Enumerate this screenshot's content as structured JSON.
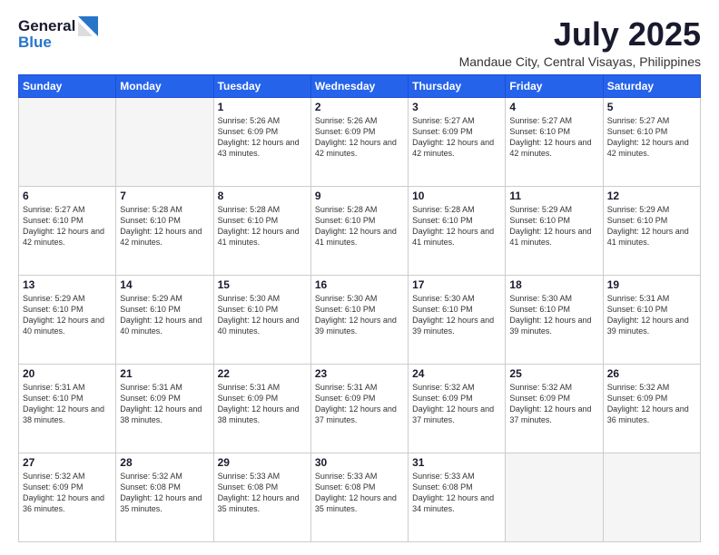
{
  "logo": {
    "general": "General",
    "blue": "Blue"
  },
  "title": "July 2025",
  "subtitle": "Mandaue City, Central Visayas, Philippines",
  "weekdays": [
    "Sunday",
    "Monday",
    "Tuesday",
    "Wednesday",
    "Thursday",
    "Friday",
    "Saturday"
  ],
  "weeks": [
    [
      {
        "day": "",
        "info": ""
      },
      {
        "day": "",
        "info": ""
      },
      {
        "day": "1",
        "info": "Sunrise: 5:26 AM\nSunset: 6:09 PM\nDaylight: 12 hours\nand 43 minutes."
      },
      {
        "day": "2",
        "info": "Sunrise: 5:26 AM\nSunset: 6:09 PM\nDaylight: 12 hours\nand 42 minutes."
      },
      {
        "day": "3",
        "info": "Sunrise: 5:27 AM\nSunset: 6:09 PM\nDaylight: 12 hours\nand 42 minutes."
      },
      {
        "day": "4",
        "info": "Sunrise: 5:27 AM\nSunset: 6:10 PM\nDaylight: 12 hours\nand 42 minutes."
      },
      {
        "day": "5",
        "info": "Sunrise: 5:27 AM\nSunset: 6:10 PM\nDaylight: 12 hours\nand 42 minutes."
      }
    ],
    [
      {
        "day": "6",
        "info": "Sunrise: 5:27 AM\nSunset: 6:10 PM\nDaylight: 12 hours\nand 42 minutes."
      },
      {
        "day": "7",
        "info": "Sunrise: 5:28 AM\nSunset: 6:10 PM\nDaylight: 12 hours\nand 42 minutes."
      },
      {
        "day": "8",
        "info": "Sunrise: 5:28 AM\nSunset: 6:10 PM\nDaylight: 12 hours\nand 41 minutes."
      },
      {
        "day": "9",
        "info": "Sunrise: 5:28 AM\nSunset: 6:10 PM\nDaylight: 12 hours\nand 41 minutes."
      },
      {
        "day": "10",
        "info": "Sunrise: 5:28 AM\nSunset: 6:10 PM\nDaylight: 12 hours\nand 41 minutes."
      },
      {
        "day": "11",
        "info": "Sunrise: 5:29 AM\nSunset: 6:10 PM\nDaylight: 12 hours\nand 41 minutes."
      },
      {
        "day": "12",
        "info": "Sunrise: 5:29 AM\nSunset: 6:10 PM\nDaylight: 12 hours\nand 41 minutes."
      }
    ],
    [
      {
        "day": "13",
        "info": "Sunrise: 5:29 AM\nSunset: 6:10 PM\nDaylight: 12 hours\nand 40 minutes."
      },
      {
        "day": "14",
        "info": "Sunrise: 5:29 AM\nSunset: 6:10 PM\nDaylight: 12 hours\nand 40 minutes."
      },
      {
        "day": "15",
        "info": "Sunrise: 5:30 AM\nSunset: 6:10 PM\nDaylight: 12 hours\nand 40 minutes."
      },
      {
        "day": "16",
        "info": "Sunrise: 5:30 AM\nSunset: 6:10 PM\nDaylight: 12 hours\nand 39 minutes."
      },
      {
        "day": "17",
        "info": "Sunrise: 5:30 AM\nSunset: 6:10 PM\nDaylight: 12 hours\nand 39 minutes."
      },
      {
        "day": "18",
        "info": "Sunrise: 5:30 AM\nSunset: 6:10 PM\nDaylight: 12 hours\nand 39 minutes."
      },
      {
        "day": "19",
        "info": "Sunrise: 5:31 AM\nSunset: 6:10 PM\nDaylight: 12 hours\nand 39 minutes."
      }
    ],
    [
      {
        "day": "20",
        "info": "Sunrise: 5:31 AM\nSunset: 6:10 PM\nDaylight: 12 hours\nand 38 minutes."
      },
      {
        "day": "21",
        "info": "Sunrise: 5:31 AM\nSunset: 6:09 PM\nDaylight: 12 hours\nand 38 minutes."
      },
      {
        "day": "22",
        "info": "Sunrise: 5:31 AM\nSunset: 6:09 PM\nDaylight: 12 hours\nand 38 minutes."
      },
      {
        "day": "23",
        "info": "Sunrise: 5:31 AM\nSunset: 6:09 PM\nDaylight: 12 hours\nand 37 minutes."
      },
      {
        "day": "24",
        "info": "Sunrise: 5:32 AM\nSunset: 6:09 PM\nDaylight: 12 hours\nand 37 minutes."
      },
      {
        "day": "25",
        "info": "Sunrise: 5:32 AM\nSunset: 6:09 PM\nDaylight: 12 hours\nand 37 minutes."
      },
      {
        "day": "26",
        "info": "Sunrise: 5:32 AM\nSunset: 6:09 PM\nDaylight: 12 hours\nand 36 minutes."
      }
    ],
    [
      {
        "day": "27",
        "info": "Sunrise: 5:32 AM\nSunset: 6:09 PM\nDaylight: 12 hours\nand 36 minutes."
      },
      {
        "day": "28",
        "info": "Sunrise: 5:32 AM\nSunset: 6:08 PM\nDaylight: 12 hours\nand 35 minutes."
      },
      {
        "day": "29",
        "info": "Sunrise: 5:33 AM\nSunset: 6:08 PM\nDaylight: 12 hours\nand 35 minutes."
      },
      {
        "day": "30",
        "info": "Sunrise: 5:33 AM\nSunset: 6:08 PM\nDaylight: 12 hours\nand 35 minutes."
      },
      {
        "day": "31",
        "info": "Sunrise: 5:33 AM\nSunset: 6:08 PM\nDaylight: 12 hours\nand 34 minutes."
      },
      {
        "day": "",
        "info": ""
      },
      {
        "day": "",
        "info": ""
      }
    ]
  ]
}
